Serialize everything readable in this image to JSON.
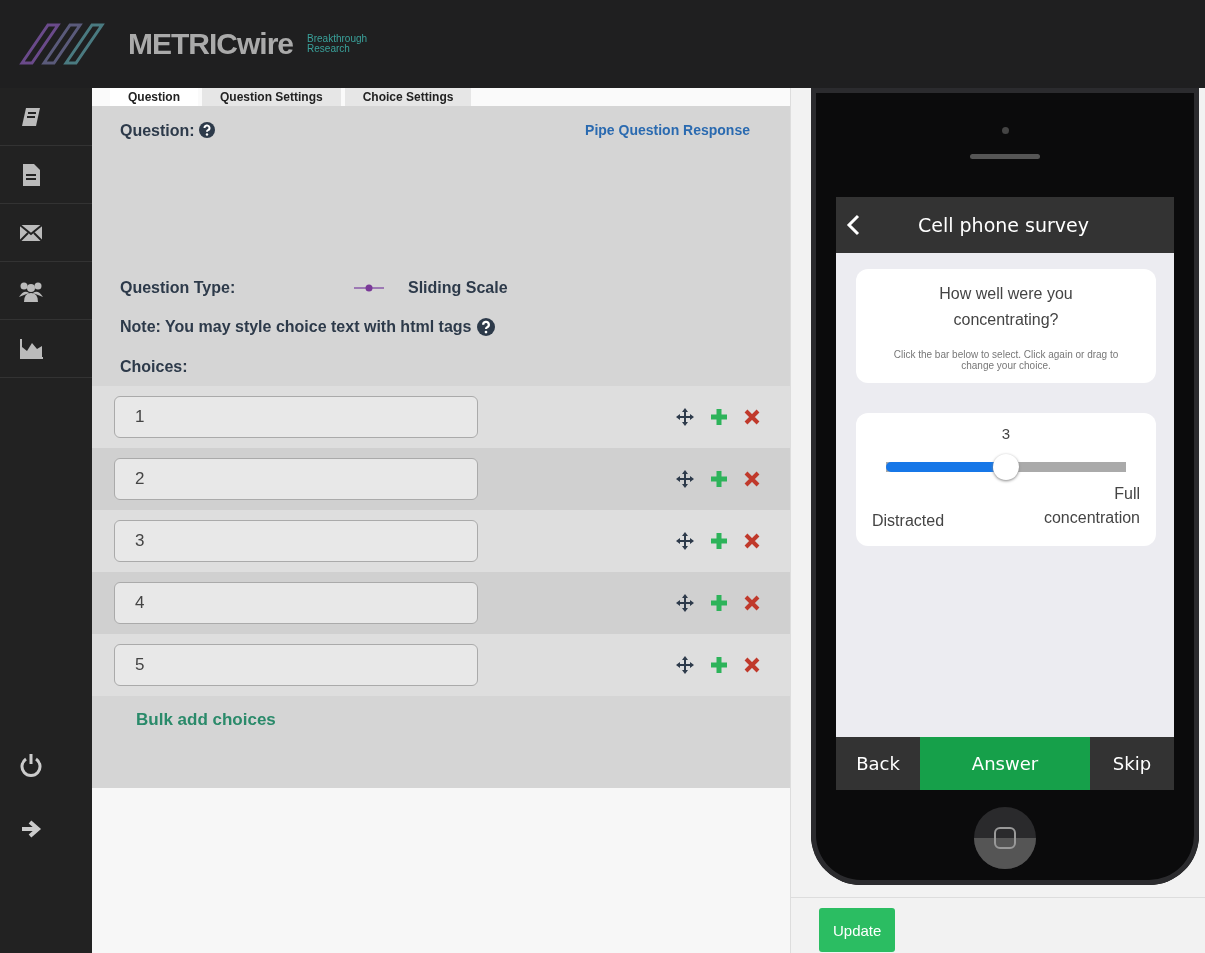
{
  "header": {
    "brand": "METRICwire",
    "tagline_1": "Breakthrough",
    "tagline_2": "Research"
  },
  "tabs": [
    {
      "label": "Question",
      "selected": true
    },
    {
      "label": "Question Settings",
      "selected": false
    },
    {
      "label": "Choice Settings",
      "selected": false
    }
  ],
  "editor": {
    "question_label": "Question:",
    "pipe_link": "Pipe Question Response",
    "type_label": "Question Type:",
    "type_value": "Sliding Scale",
    "note": "Note: You may style choice text with html tags",
    "choices_label": "Choices:",
    "choices": [
      {
        "value": "1"
      },
      {
        "value": "2"
      },
      {
        "value": "3"
      },
      {
        "value": "4"
      },
      {
        "value": "5"
      }
    ],
    "bulk_add": "Bulk add choices"
  },
  "preview": {
    "title": "Cell phone survey",
    "question": "How well were you concentrating?",
    "instructions": "Click the bar below to select. Click again or drag to change your choice.",
    "slider": {
      "reading": "3",
      "level": 0.5,
      "min_label": "Distracted",
      "max_label": "Full concentration"
    },
    "nav": [
      {
        "label": "Back",
        "selected": false
      },
      {
        "label": "Answer",
        "selected": true
      },
      {
        "label": "Skip",
        "selected": false
      }
    ]
  },
  "update_button": "Update"
}
